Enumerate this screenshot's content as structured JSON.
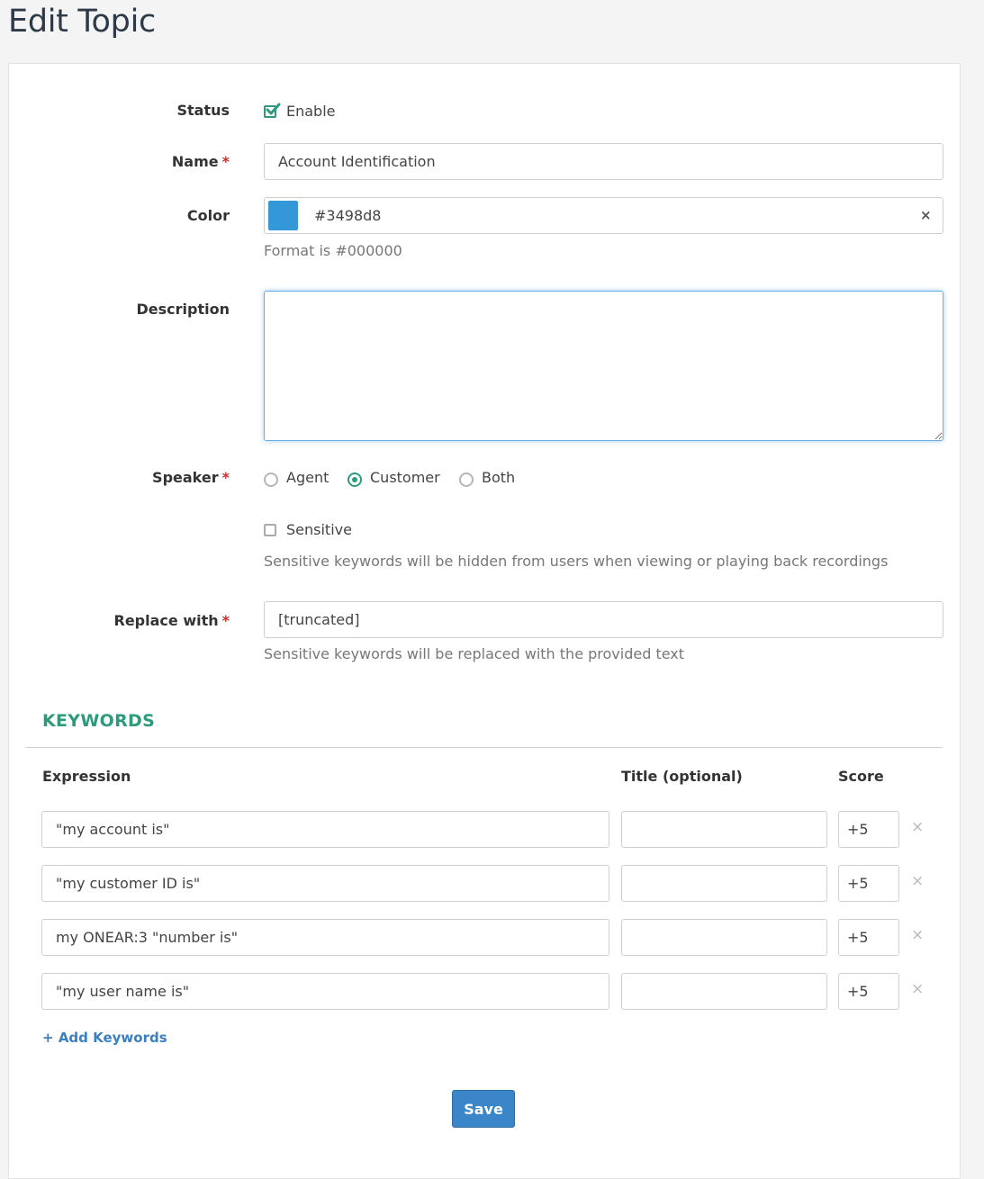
{
  "page": {
    "title": "Edit Topic"
  },
  "form": {
    "status": {
      "label": "Status",
      "option_label": "Enable",
      "checked": true
    },
    "name": {
      "label": "Name",
      "required_mark": "*",
      "value": "Account Identification"
    },
    "color": {
      "label": "Color",
      "value": "#3498d8",
      "swatch": "#3498d8",
      "help": "Format is #000000",
      "clear_icon": "close-icon"
    },
    "description": {
      "label": "Description",
      "value": ""
    },
    "speaker": {
      "label": "Speaker",
      "required_mark": "*",
      "options": [
        {
          "label": "Agent",
          "selected": false
        },
        {
          "label": "Customer",
          "selected": true
        },
        {
          "label": "Both",
          "selected": false
        }
      ]
    },
    "sensitive": {
      "label": "Sensitive",
      "checked": false,
      "help": "Sensitive keywords will be hidden from users when viewing or playing back recordings"
    },
    "replace_with": {
      "label": "Replace with",
      "required_mark": "*",
      "value": "[truncated]",
      "help": "Sensitive keywords will be replaced with the provided text"
    }
  },
  "keywords": {
    "title": "KEYWORDS",
    "headers": {
      "expression": "Expression",
      "title": "Title (optional)",
      "score": "Score"
    },
    "rows": [
      {
        "expression": "\"my account is\"",
        "title": "",
        "score": "+5"
      },
      {
        "expression": "\"my customer ID is\"",
        "title": "",
        "score": "+5"
      },
      {
        "expression": "my ONEAR:3 \"number is\"",
        "title": "",
        "score": "+5"
      },
      {
        "expression": "\"my user name is\"",
        "title": "",
        "score": "+5"
      }
    ],
    "remove_glyph": "×",
    "add_label": "Add Keywords",
    "add_glyph": "+"
  },
  "actions": {
    "save_label": "Save"
  },
  "colors": {
    "accent": "#2e9a7d",
    "primary": "#3b86c8",
    "required": "#c9302c",
    "link": "#3a7fc1"
  }
}
